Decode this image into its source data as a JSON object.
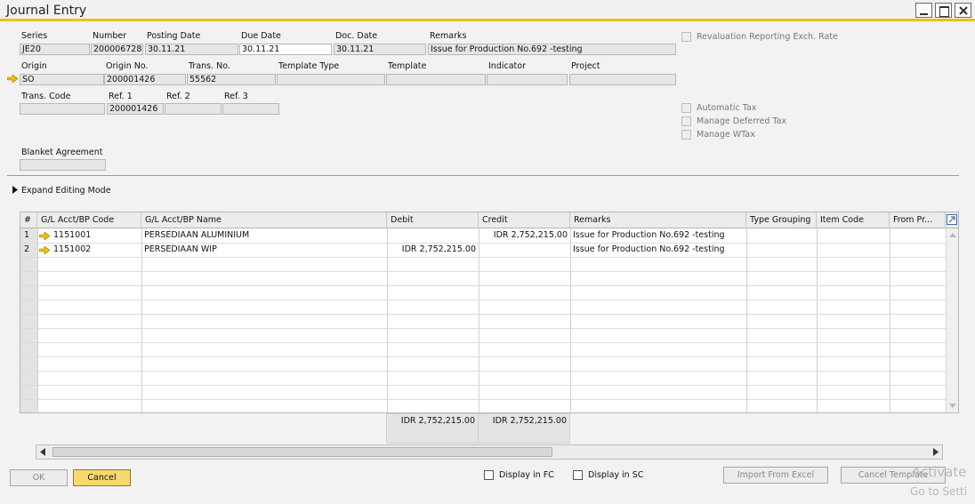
{
  "window": {
    "title": "Journal Entry"
  },
  "header": {
    "series_label": "Series",
    "series_value": "JE20",
    "number_label": "Number",
    "number_value": "200006728",
    "posting_date_label": "Posting Date",
    "posting_date_value": "30.11.21",
    "due_date_label": "Due Date",
    "due_date_value": "30.11.21",
    "doc_date_label": "Doc. Date",
    "doc_date_value": "30.11.21",
    "remarks_label": "Remarks",
    "remarks_value": "Issue for Production No.692 -testing",
    "origin_label": "Origin",
    "origin_value": "SO",
    "origin_no_label": "Origin No.",
    "origin_no_value": "200001426",
    "trans_no_label": "Trans. No.",
    "trans_no_value": "55562",
    "template_type_label": "Template Type",
    "template_type_value": "",
    "template_label": "Template",
    "template_value": "",
    "indicator_label": "Indicator",
    "indicator_value": "",
    "project_label": "Project",
    "project_value": "",
    "trans_code_label": "Trans. Code",
    "trans_code_value": "",
    "ref1_label": "Ref. 1",
    "ref1_value": "200001426",
    "ref2_label": "Ref. 2",
    "ref2_value": "",
    "ref3_label": "Ref. 3",
    "ref3_value": "",
    "blanket_agreement_label": "Blanket Agreement",
    "blanket_agreement_value": ""
  },
  "options": {
    "revaluation_label": "Revaluation Reporting Exch. Rate",
    "automatic_tax_label": "Automatic Tax",
    "manage_deferred_tax_label": "Manage Deferred Tax",
    "manage_wtax_label": "Manage WTax"
  },
  "expand_editing_label": "Expand Editing Mode",
  "grid": {
    "columns": [
      "#",
      "G/L Acct/BP Code",
      "G/L Acct/BP Name",
      "Debit",
      "Credit",
      "Remarks",
      "Type Grouping",
      "Item Code",
      "From Pr..."
    ],
    "rows": [
      {
        "num": "1",
        "code": "1151001",
        "name": "PERSEDIAAN ALUMINIUM",
        "debit": "",
        "credit": "IDR 2,752,215.00",
        "remarks": "Issue for Production No.692 -testing"
      },
      {
        "num": "2",
        "code": "1151002",
        "name": "PERSEDIAAN WIP",
        "debit": "IDR 2,752,215.00",
        "credit": "",
        "remarks": "Issue for Production No.692 -testing"
      }
    ],
    "total_debit": "IDR 2,752,215.00",
    "total_credit": "IDR 2,752,215.00"
  },
  "footer": {
    "ok_label": "OK",
    "cancel_label": "Cancel",
    "display_fc_label": "Display in FC",
    "display_sc_label": "Display in SC",
    "import_excel_label": "Import From Excel",
    "cancel_template_label": "Cancel Template"
  },
  "watermark": {
    "line1": "Activate",
    "line2": "Go to Setti"
  },
  "colors": {
    "accent_bar": "#f0c000",
    "cancel_button": "#f8d86c",
    "link_arrow": "#f0c000"
  }
}
